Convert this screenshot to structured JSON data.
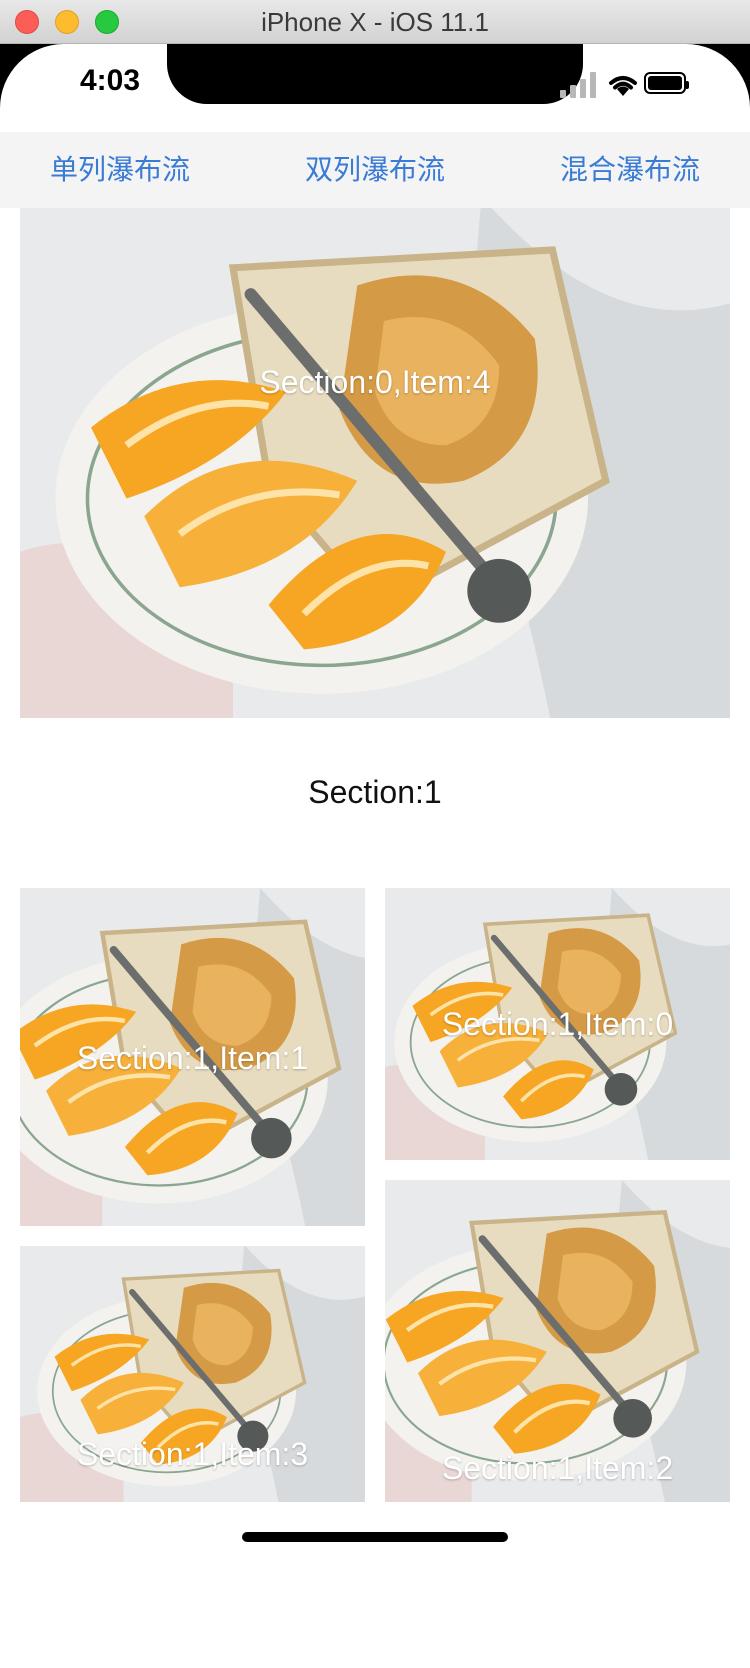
{
  "window": {
    "title": "iPhone X - iOS 11.1"
  },
  "status_bar": {
    "time": "4:03",
    "icons": [
      "signal-icon",
      "wifi-icon",
      "battery-icon"
    ]
  },
  "nav": {
    "items": [
      {
        "label": "单列瀑布流"
      },
      {
        "label": "双列瀑布流"
      },
      {
        "label": "混合瀑布流"
      }
    ]
  },
  "collection": {
    "section0": {
      "items": [
        {
          "label": "Section:0,Item:4"
        }
      ]
    },
    "section1": {
      "header": "Section:1",
      "items": [
        {
          "label": "Section:1,Item:1"
        },
        {
          "label": "Section:1,Item:0"
        },
        {
          "label": "Section:1,Item:3"
        },
        {
          "label": "Section:1,Item:2"
        }
      ]
    }
  },
  "colors": {
    "accent": "#3a7bd5",
    "nav_bg": "#f4f4f4"
  }
}
